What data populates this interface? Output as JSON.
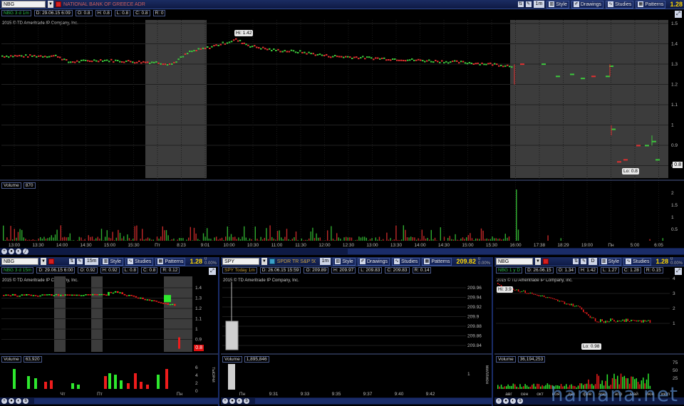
{
  "main": {
    "symbol": "NBG",
    "description": "NATIONAL BANK OF GREECE ADR",
    "timeframe": "1m",
    "last": "1.28",
    "toolbar": {
      "style": "Style",
      "drawings": "Drawings",
      "studies": "Studies",
      "patterns": "Patterns"
    },
    "info": {
      "name": "NBG 3 d 1m",
      "d": "D: 29.06.15 6:09",
      "o": "O: 0.8",
      "h": "H: 0.8",
      "l": "L: 0.8",
      "c": "C: 0.8",
      "r": "R: 0"
    },
    "copyright": "2015 © TD Ameritrade IP Company, Inc.",
    "hi_label": "Hi: 1.42",
    "lo_label": "Lo: 0.8",
    "price_tag": "0.8",
    "price_ticks": [
      "1.5",
      "1.4",
      "1.3",
      "1.2",
      "1.1",
      "1",
      "0.9",
      "0.8"
    ],
    "time_ticks": [
      "13:00",
      "13:30",
      "14:00",
      "14:30",
      "15:00",
      "15:30",
      "Пт",
      "8:23",
      "9:01",
      "10:00",
      "10:30",
      "11:00",
      "11:30",
      "12:00",
      "12:30",
      "13:00",
      "13:30",
      "14:00",
      "14:30",
      "15:00",
      "15:30",
      "16:00",
      "17:38",
      "18:29",
      "19:00",
      "Пн",
      "5:00",
      "6:05"
    ],
    "volume": {
      "label": "Volume",
      "value": "870",
      "ticks": [
        "2",
        "1.5",
        "1",
        "0.5"
      ]
    }
  },
  "left": {
    "symbol": "NBG",
    "timeframe": "15m",
    "last": "1.28",
    "change": "0",
    "change_pct": "0.00%",
    "toolbar": {
      "style": "Style",
      "studies": "Studies",
      "patterns": "Patterns"
    },
    "info": {
      "name": "NBG 3 d 15m",
      "d": "D: 29.06.15 6:00",
      "o": "O: 0.92",
      "h": "H: 0.92",
      "l": "L: 0.8",
      "c": "C: 0.8",
      "r": "R: 0.12"
    },
    "copyright": "2015 © TD Ameritrade IP Company, Inc.",
    "price_tag": "0.8",
    "price_ticks": [
      "1.4",
      "1.3",
      "1.2",
      "1.1",
      "1",
      "0.9"
    ],
    "time_ticks": [
      "Чт",
      "Пт",
      "Пн"
    ],
    "volume": {
      "label": "Volume",
      "value": "63,920",
      "ticks": [
        "6",
        "4",
        "2",
        "0"
      ],
      "unit": "тысячи"
    }
  },
  "center": {
    "symbol": "SPY",
    "description": "SPDR TR S&P 50",
    "timeframe": "1m",
    "last": "209.82",
    "change": "0",
    "change_pct": "0.00%",
    "toolbar": {
      "style": "Style",
      "drawings": "Drawings",
      "studies": "Studies",
      "patterns": "Patterns"
    },
    "info": {
      "name": "SPY Today 1m",
      "d": "D: 26.06.15 15:59",
      "o": "O: 209.89",
      "h": "H: 209.97",
      "l": "L: 209.83",
      "c": "C: 209.83",
      "r": "R: 0.14"
    },
    "copyright": "2015 © TD Ameritrade IP Company, Inc.",
    "price_ticks": [
      "209.96",
      "209.94",
      "209.92",
      "209.9",
      "209.88",
      "209.86",
      "209.84"
    ],
    "time_ticks": [
      "Пн",
      "9:31",
      "9:33",
      "9:35",
      "9:37",
      "9:40",
      "9:42"
    ],
    "volume": {
      "label": "Volume",
      "value": "1,895,846",
      "ticks": [
        "1"
      ],
      "unit": "миллион"
    }
  },
  "right": {
    "symbol": "NBG",
    "timeframe": "D",
    "last": "1.28",
    "change": "0",
    "change_pct": "0.00%",
    "toolbar": {
      "style": "Style",
      "studies": "Studies"
    },
    "info": {
      "name": "NBG 1 y D",
      "d": "D: 26.06.15",
      "o": "O: 1.34",
      "h": "H: 1.42",
      "l": "L: 1.27",
      "c": "C: 1.28",
      "r": "R: 0.15"
    },
    "copyright": "2015 © TD Ameritrade IP Company, Inc.",
    "hi_label": "Hi: 3.9",
    "lo_label": "Lo: 0.98",
    "price_ticks": [
      "4",
      "3",
      "2",
      "1"
    ],
    "time_ticks": [
      "авг",
      "сен",
      "окт",
      "ноя",
      "дек",
      "фев",
      "мар",
      "апр",
      "май",
      "июн",
      "июл"
    ],
    "volume": {
      "label": "Volume",
      "value": "36,194,253",
      "ticks": [
        "75",
        "50",
        "25"
      ]
    }
  },
  "watermark": "hamana.net"
}
